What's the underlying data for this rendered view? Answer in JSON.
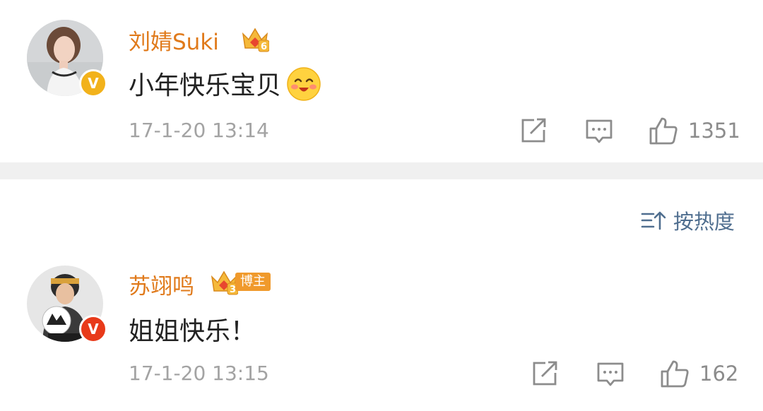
{
  "comments": [
    {
      "username": "刘婧Suki",
      "level_badge": "6",
      "content": "小年快乐宝贝",
      "emoji": "blushing-smile-emoji",
      "timestamp": "17-1-20 13:14",
      "likes": "1351",
      "verified": true,
      "verified_mark": "V"
    },
    {
      "username": "苏翊鸣",
      "level_badge": "3",
      "host_tag": "博主",
      "content": "姐姐快乐！",
      "timestamp": "17-1-20 13:15",
      "likes": "162",
      "verified": true,
      "verified_mark": "V"
    }
  ],
  "sort": {
    "label": "按热度",
    "icon": "sort-icon"
  },
  "actions": {
    "share_icon": "share-icon",
    "reply_icon": "comment-icon",
    "like_icon": "thumbs-up-icon"
  },
  "colors": {
    "username": "#e07a1b",
    "verified_badge_1": "#f2b21b",
    "verified_badge_2": "#e83a1a",
    "sort_text": "#4f6e8f",
    "divider": "#f0f0f0",
    "timestamp": "#a3a3a3"
  }
}
